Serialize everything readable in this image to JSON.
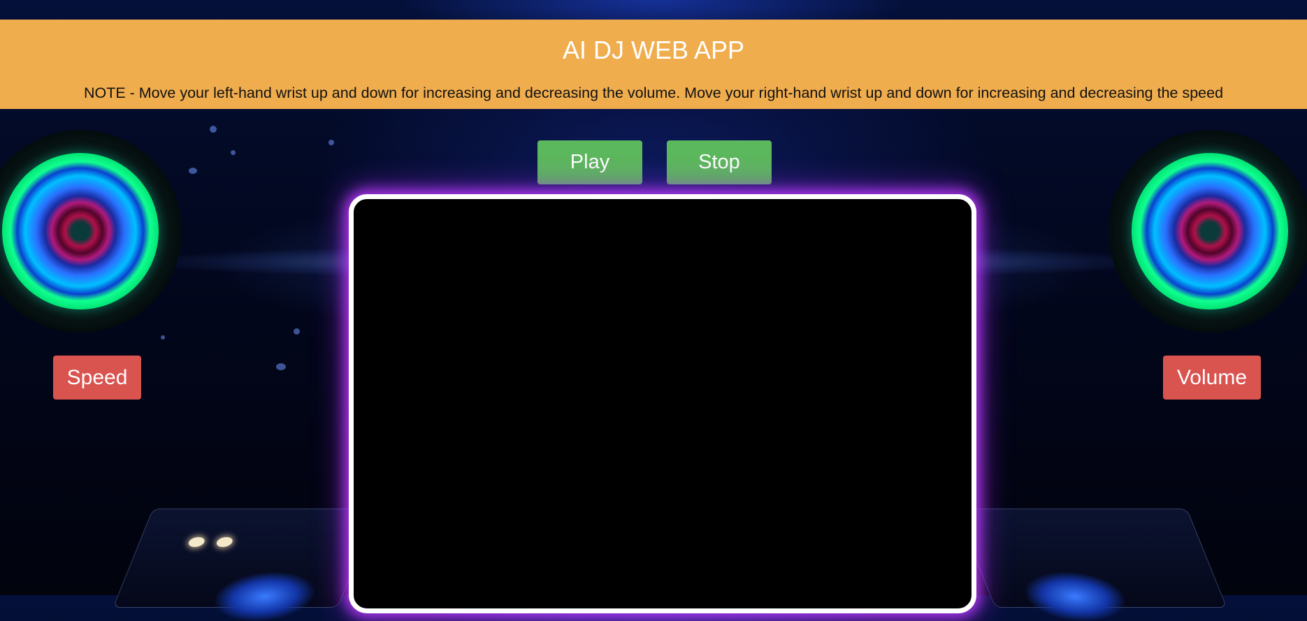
{
  "header": {
    "title": "AI DJ WEB APP",
    "note": "NOTE - Move your left-hand wrist up and down for increasing and decreasing the volume. Move your right-hand wrist up and down for increasing and decreasing the speed"
  },
  "controls": {
    "play_label": "Play",
    "stop_label": "Stop",
    "speed_label": "Speed",
    "volume_label": "Volume"
  },
  "colors": {
    "banner": "#f0ad4e",
    "button_green": "#5cb85c",
    "button_red": "#d9534f",
    "video_glow": "#be3cff"
  },
  "icons": [
    "speaker-icon",
    "dj-deck-icon"
  ]
}
